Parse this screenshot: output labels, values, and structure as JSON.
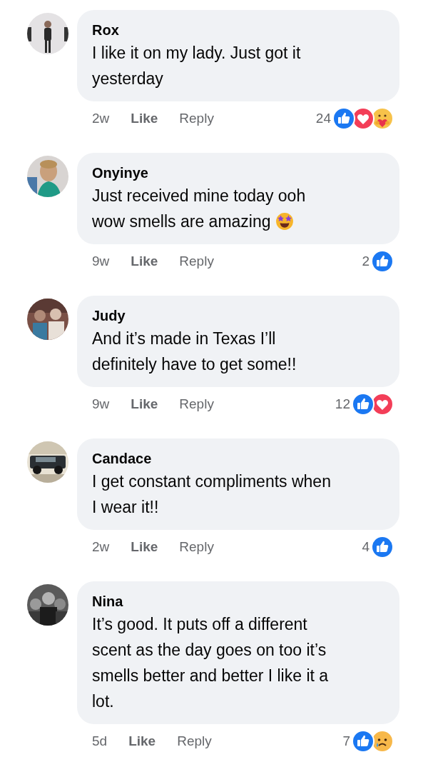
{
  "comments": [
    {
      "author": "Rox",
      "lines": [
        "I like it on my lady. Just got it",
        "yesterday"
      ],
      "time": "2w",
      "like": "Like",
      "reply": "Reply",
      "count": "24",
      "reactions": [
        {
          "kind": "like"
        },
        {
          "kind": "love"
        },
        {
          "kind": "care"
        }
      ]
    },
    {
      "author": "Onyinye",
      "lines": [
        "Just received mine today ooh",
        "wow smells are amazing"
      ],
      "emoji": {
        "kind": "starstruck"
      },
      "time": "9w",
      "like": "Like",
      "reply": "Reply",
      "count": "2",
      "reactions": [
        {
          "kind": "like"
        }
      ]
    },
    {
      "author": "Judy",
      "lines": [
        "And it’s made in Texas I’ll",
        "definitely have to get some!!"
      ],
      "time": "9w",
      "like": "Like",
      "reply": "Reply",
      "count": "12",
      "reactions": [
        {
          "kind": "like"
        },
        {
          "kind": "love"
        }
      ]
    },
    {
      "author": "Candace",
      "lines": [
        "I get constant compliments when",
        "I wear it!!"
      ],
      "time": "2w",
      "like": "Like",
      "reply": "Reply",
      "count": "4",
      "reactions": [
        {
          "kind": "like"
        }
      ]
    },
    {
      "author": "Nina",
      "lines": [
        "It’s good. It puts off a different",
        "scent as the day goes on too it’s",
        "smells better and better I like it a",
        "lot."
      ],
      "time": "5d",
      "like": "Like",
      "reply": "Reply",
      "count": "7",
      "reactions": [
        {
          "kind": "like"
        },
        {
          "kind": "sad"
        }
      ]
    }
  ]
}
